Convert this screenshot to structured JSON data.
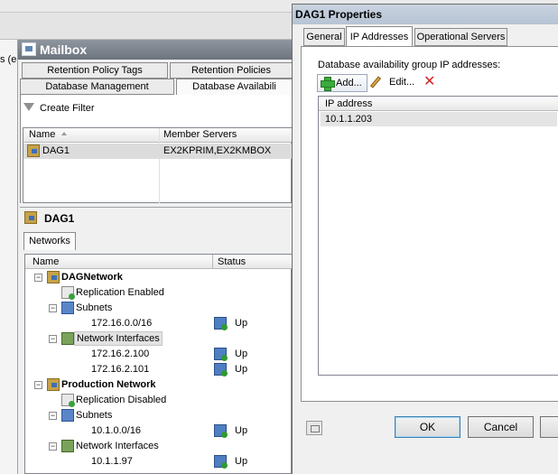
{
  "background": {
    "left_clip_text": "s (e",
    "mailbox_title": "Mailbox",
    "tabs_row1": [
      "Retention Policy Tags",
      "Retention Policies"
    ],
    "tabs_row2": [
      "Database Management",
      "Database Availabili"
    ],
    "create_filter": "Create Filter",
    "dag_list": {
      "columns": [
        "Name",
        "Member Servers"
      ],
      "rows": [
        {
          "name": "DAG1",
          "servers": "EX2KPRIM,EX2KMBOX"
        }
      ]
    },
    "dag_detail_title": "DAG1",
    "networks_tab": "Networks",
    "tree": {
      "columns": [
        "Name",
        "Status"
      ],
      "dagnetwork": "DAGNetwork",
      "replication_enabled": "Replication Enabled",
      "subnets_1": "Subnets",
      "subnet_1": "172.16.0.0/16",
      "subnet_1_status": "Up",
      "network_interfaces_1": "Network Interfaces",
      "nic_1": "172.16.2.100",
      "nic_1_status": "Up",
      "nic_2": "172.16.2.101",
      "nic_2_status": "Up",
      "production_network": "Production Network",
      "replication_disabled": "Replication Disabled",
      "subnets_2": "Subnets",
      "subnet_2": "10.1.0.0/16",
      "subnet_2_status": "Up",
      "network_interfaces_2": "Network Interfaces",
      "nic_3": "10.1.1.97",
      "nic_3_status": "Up"
    }
  },
  "dialog": {
    "title": "DAG1 Properties",
    "tabs": [
      "General",
      "IP Addresses",
      "Operational Servers"
    ],
    "active_tab": "IP Addresses",
    "group_label": "Database availability group IP addresses:",
    "toolbar": {
      "add": "Add...",
      "edit": "Edit..."
    },
    "ip_list": {
      "column": "IP address",
      "rows": [
        "10.1.1.203"
      ]
    },
    "buttons": {
      "ok": "OK",
      "cancel": "Cancel"
    }
  },
  "colors": {
    "delete_icon": "#dd2222",
    "add_icon": "#3cab3c",
    "selected_row": "#dcdcdc"
  }
}
